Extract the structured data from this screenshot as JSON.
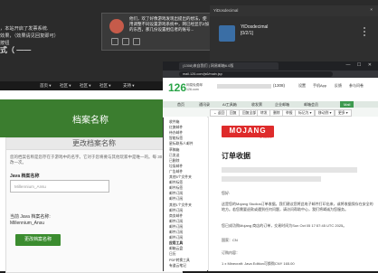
{
  "background_left": {
    "lines": [
      "，本站开启了发票系统.",
      "效果，（效果请见回复即可）",
      "按钮"
    ],
    "section_title": "式（ ——"
  },
  "popup": {
    "text": "他们，欢了好像游戏发现出提出的想法，使用调整不同设置游戏系统中，网已经显示2加的东西，那几份设置相信者的账号...",
    "icon_names": [
      "image-icon",
      "emoji-icon",
      "more-icon"
    ]
  },
  "notif_top": {
    "title": "YiDosdecimal",
    "close": "×"
  },
  "panel_right": {
    "name_line1": "YiDosdecimal",
    "name_line2": "[0/2/1]"
  },
  "site": {
    "nav": [
      "首页 ▾",
      "社区 ▾",
      "社区 ▾",
      "社区 ▾",
      "支持 ▾"
    ],
    "hero_title": "档案名称",
    "card_title": "更改档案名称",
    "card_desc": "您的档案名称是您存在于游戏中的名字。它对于您将要与其他玩家中是唯一的。每 30 天只能更改一次。",
    "java_label": "Java 档案名称",
    "input_placeholder": "Millennium_Ansu",
    "current_label": "当前 Java 档案名称:",
    "current_value": "Millennium_Ansu",
    "submit": "更改档案名称"
  },
  "browser": {
    "tab_title": "(1308)来自我们 | 网易邮箱6.0版",
    "url": "mail.126.com/js6/main.jsp",
    "window_controls": "— ☐ ✕"
  },
  "mail": {
    "logo": "126",
    "logo_sub": "网易免费邮",
    "logo_sub2": "126.com",
    "account_count": "(1308)",
    "links": [
      "设置",
      "手机App",
      "反馈",
      "参与问卷"
    ],
    "tabs": [
      "首页",
      "通讯录",
      "AI工具箱",
      "收发票",
      "企业邮箱",
      "邮箱会员",
      "Mail"
    ],
    "tools": [
      "← 返回",
      "回复",
      "回复全部",
      "转发",
      "删除",
      "举报",
      "标记为 ▾",
      "移动到 ▾",
      "更多 ▾"
    ],
    "side_items": [
      {
        "text": "收件箱",
        "sec": false
      },
      {
        "text": "红旗邮件",
        "sec": false
      },
      {
        "text": "待办邮件",
        "sec": false
      },
      {
        "text": "智能标签",
        "sec": false
      },
      {
        "text": "星标联系人邮件",
        "sec": false
      },
      {
        "text": "草稿箱",
        "sec": false
      },
      {
        "text": "已发送",
        "sec": false
      },
      {
        "text": "已删除",
        "sec": false
      },
      {
        "text": "垃圾邮件",
        "sec": false
      },
      {
        "text": "广告邮件",
        "sec": false
      },
      {
        "text": "其他5个文件夹",
        "sec": false
      },
      {
        "text": "邮件标签",
        "sec": false
      },
      {
        "text": "邮件标签",
        "sec": false
      },
      {
        "text": "邮件订阅",
        "sec": false
      },
      {
        "text": "邮件订阅",
        "sec": false
      },
      {
        "text": "其他1个文件夹",
        "sec": false
      },
      {
        "text": "邮件订阅",
        "sec": false
      },
      {
        "text": "商务邮件",
        "sec": false
      },
      {
        "text": "邮件订阅",
        "sec": false
      },
      {
        "text": "邮件订阅",
        "sec": false
      },
      {
        "text": "邮件订阅",
        "sec": false
      },
      {
        "text": "邮件订阅",
        "sec": false
      },
      {
        "text": "应用工具",
        "sec": true
      },
      {
        "text": "邮箱云盘",
        "sec": false
      },
      {
        "text": "日历",
        "sec": false
      },
      {
        "text": "PDF转换工具",
        "sec": false
      },
      {
        "text": "有道云笔记",
        "sec": false
      }
    ],
    "mojang": "MOJANG",
    "mojang_sub": "STUDIOS",
    "title": "订单收据",
    "para1": "您好:",
    "para2": "这是您的Mojang Studios订单收据。我们建议您将此电子邮件打印出来，或将收据保存在安全的地方。若您需要退款或遇到任何问题，请访问帮助中心，我们将竭诚为您服务。",
    "para3_prefix": "您已成功购Mojang 商店的订单，交易时间为Sun Oct 05 17:57:45 UTC 2025。",
    "country": "国家：CN",
    "order_label": "订购内容：",
    "order_item": "1 x Minecraft: Java Edition可换购CNY 165.00"
  }
}
